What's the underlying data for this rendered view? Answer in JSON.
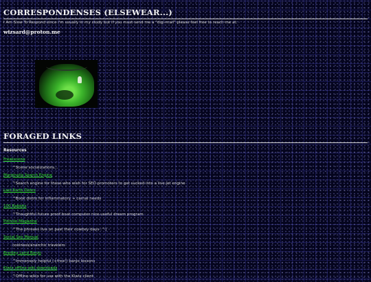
{
  "correspondence": {
    "heading": "CORRESPONDENSES (ELSEWEAR...)",
    "intro": "I Am Slow To Respond since i'm usually in my study but if you must send me a \"digi-mail\" please feel free to reach me at:",
    "email": "wizsard@proton.me"
  },
  "links_section": {
    "heading": "FORAGED LINKS",
    "resources_label": "Resources",
    "items": [
      {
        "label": "Freakscene",
        "desc": "^Scene socializations..."
      },
      {
        "label": "Marginalia Search Engine",
        "desc": "^Search engine for those who wish for SEO promoters to get sucked into a live jet engine"
      },
      {
        "label": "Last Earth Distro",
        "desc": "^Book distro for inflammatory + carnal needs"
      },
      {
        "label": "100 Rabbits",
        "desc": "^Thoughtful future proof boat computer nice useful dream program"
      },
      {
        "label": "Pinhole Magazine",
        "desc": "^The phreaks live on past their cowboy days :^]"
      },
      {
        "label": "Social Sex Manual",
        "desc": "coolness/anarchic travelers"
      },
      {
        "label": "Bradley Laird Banjo",
        "desc": "^Immensely helpful (+free!) banjo lessons"
      },
      {
        "label": "Kiwix offline wiki downloads",
        "desc": "^Offline wikis for use with the Kiwix client"
      }
    ]
  }
}
